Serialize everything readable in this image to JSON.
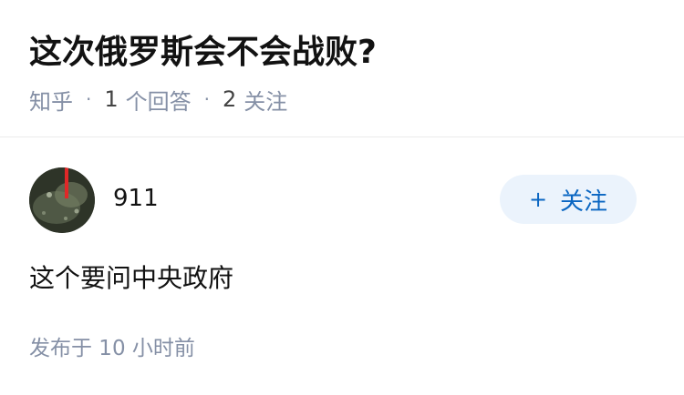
{
  "question": {
    "title": "这次俄罗斯会不会战败?",
    "source": "知乎",
    "answer_count": "1",
    "answer_label": "个回答",
    "follow_count": "2",
    "follow_label": "关注"
  },
  "answer": {
    "author_name": "911",
    "follow_button_label": "关注",
    "follow_button_icon": "plus-icon",
    "content": "这个要问中央政府",
    "published": "发布于 10 小时前"
  },
  "colors": {
    "accent": "#0a66c2",
    "button_bg": "#ebf3fc",
    "meta_text": "#8590a6"
  }
}
